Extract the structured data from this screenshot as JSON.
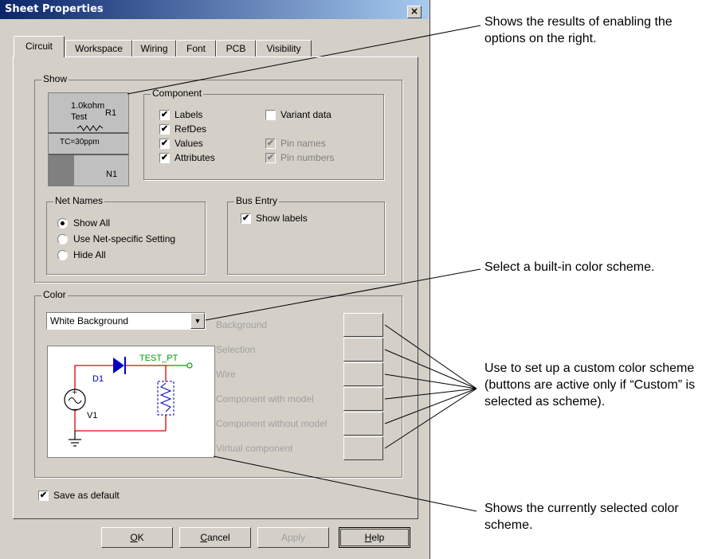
{
  "dialog": {
    "title": "Sheet Properties",
    "close_glyph": "×",
    "tabs": [
      {
        "label": "Circuit",
        "active": true
      },
      {
        "label": "Workspace",
        "active": false
      },
      {
        "label": "Wiring",
        "active": false
      },
      {
        "label": "Font",
        "active": false
      },
      {
        "label": "PCB",
        "active": false
      },
      {
        "label": "Visibility",
        "active": false
      }
    ],
    "show": {
      "title": "Show",
      "preview": {
        "value": "1.0kohm",
        "name": "Test",
        "refdes": "R1",
        "attr": "TC=30ppm",
        "net": "N1"
      },
      "component": {
        "title": "Component",
        "options": [
          {
            "label": "Labels",
            "checked": true,
            "enabled": true
          },
          {
            "label": "RefDes",
            "checked": true,
            "enabled": true
          },
          {
            "label": "Values",
            "checked": true,
            "enabled": true
          },
          {
            "label": "Attributes",
            "checked": true,
            "enabled": true
          },
          {
            "label": "Variant data",
            "checked": false,
            "enabled": true
          },
          {
            "label": "Pin names",
            "checked": true,
            "enabled": false
          },
          {
            "label": "Pin numbers",
            "checked": true,
            "enabled": false
          }
        ]
      },
      "net_names": {
        "title": "Net Names",
        "options": [
          {
            "label": "Show All",
            "selected": true
          },
          {
            "label": "Use Net-specific Setting",
            "selected": false
          },
          {
            "label": "Hide All",
            "selected": false
          }
        ]
      },
      "bus_entry": {
        "title": "Bus Entry",
        "show_labels": {
          "label": "Show labels",
          "checked": true
        }
      }
    },
    "color": {
      "title": "Color",
      "scheme": "White Background",
      "items": [
        "Background",
        "Selection",
        "Wire",
        "Component with model",
        "Component without model",
        "Virtual component"
      ],
      "preview": {
        "probe": "TEST_PT",
        "diode": "D1",
        "source": "V1"
      }
    },
    "save_default": {
      "label": "Save as default",
      "checked": true
    },
    "buttons": {
      "ok": {
        "accel": "O",
        "rest": "K"
      },
      "cancel": {
        "accel": "C",
        "rest": "ancel"
      },
      "apply": {
        "label": "Apply"
      },
      "help": {
        "accel": "H",
        "rest": "elp"
      }
    }
  },
  "annotations": {
    "a1": "Shows the results of enabling the options on the right.",
    "a2": "Select a built-in color scheme.",
    "a3": "Use to set up a custom color scheme (buttons are active only if “Custom” is selected as scheme).",
    "a4": "Shows the currently selected color scheme."
  },
  "colors": {
    "dialog_face": "#d4d0c8",
    "titlebar_start": "#0a246a",
    "titlebar_end": "#a6caf0",
    "wire_red": "#e00000",
    "probe_green": "#00a000",
    "component_blue": "#0000c0",
    "disabled_text": "#a0a0a0"
  }
}
